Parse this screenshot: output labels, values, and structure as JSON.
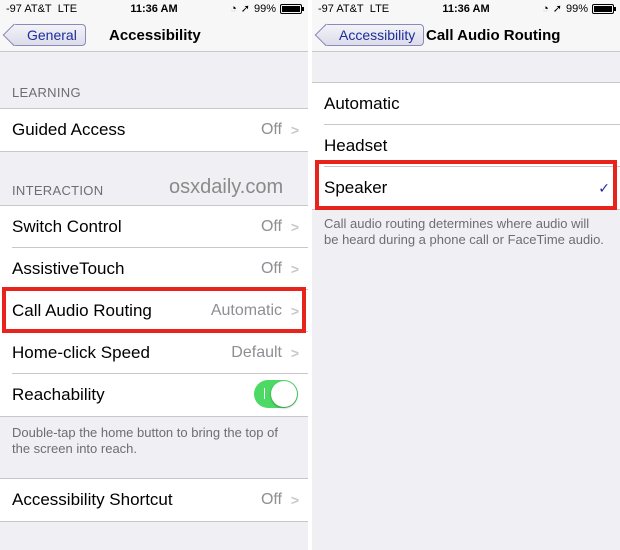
{
  "left_screen": {
    "status": {
      "carrier": "-97 AT&T",
      "network": "LTE",
      "time": "11:36 AM",
      "battery": "99%"
    },
    "nav": {
      "back_label": "General",
      "title": "Accessibility"
    },
    "learning": {
      "header": "LEARNING",
      "rows": [
        {
          "label": "Guided Access",
          "value": "Off"
        }
      ]
    },
    "interaction": {
      "header": "INTERACTION",
      "rows": [
        {
          "label": "Switch Control",
          "value": "Off"
        },
        {
          "label": "AssistiveTouch",
          "value": "Off"
        },
        {
          "label": "Call Audio Routing",
          "value": "Automatic"
        },
        {
          "label": "Home-click Speed",
          "value": "Default"
        },
        {
          "label": "Reachability",
          "toggle_on": true
        }
      ],
      "footer": "Double-tap the home button to bring the top of the screen into reach."
    },
    "shortcut": {
      "rows": [
        {
          "label": "Accessibility Shortcut",
          "value": "Off"
        }
      ]
    },
    "watermark": "osxdaily.com"
  },
  "right_screen": {
    "status": {
      "carrier": "-97 AT&T",
      "network": "LTE",
      "time": "11:36 AM",
      "battery": "99%"
    },
    "nav": {
      "back_label": "Accessibility",
      "title": "Call Audio Routing"
    },
    "options": [
      {
        "label": "Automatic",
        "selected": false
      },
      {
        "label": "Headset",
        "selected": false
      },
      {
        "label": "Speaker",
        "selected": true
      }
    ],
    "footer": "Call audio routing determines where audio will be heard during a phone call or FaceTime audio."
  },
  "colors": {
    "highlight": "#e8231b",
    "toggle_on": "#4cd964",
    "tint": "#1d2d9a",
    "background": "#efeff4"
  },
  "icons": [
    "chevron-right-icon",
    "checkmark-icon",
    "location-icon",
    "battery-icon",
    "toggle-switch"
  ]
}
